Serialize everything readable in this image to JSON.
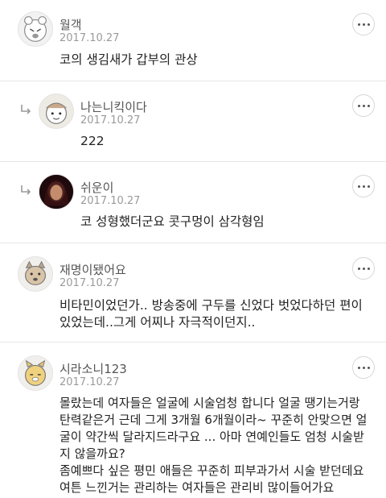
{
  "comments": [
    {
      "nickname": "월객",
      "date": "2017.10.27",
      "text": "코의 생김새가 갑부의 관상",
      "reply": false
    },
    {
      "nickname": "나는니킥이다",
      "date": "2017.10.27",
      "text": "222",
      "reply": true
    },
    {
      "nickname": "쉬운이",
      "date": "2017.10.27",
      "text": "코 성형했더군요 콧구멍이 삼각형임",
      "reply": true
    },
    {
      "nickname": "재명이됐어요",
      "date": "2017.10.27",
      "text": "비타민이었던가.. 방송중에 구두를 신었다 벗었다하던 편이\n있었는데..그게 어찌나 자극적이던지..",
      "reply": false
    },
    {
      "nickname": "시라소니123",
      "date": "2017.10.27",
      "text": "몰랐는데 여자들은 얼굴에 시술엄청 합니다 얼굴 땡기는거랑\n탄력같은거 근데 그게 3개월 6개월이라~ 꾸준히 안맞으면 얼\n굴이 약간씩 달라지드라구요 ... 아마 연예인들도 엄청 시술받\n지 않을까요?\n좀예쁘다 싶은 평민 애들은 꾸준히 피부과가서 시술 받던데요\n여튼 느낀거는 관리하는 여자들은 관리비 많이들어가요",
      "reply": false
    }
  ]
}
